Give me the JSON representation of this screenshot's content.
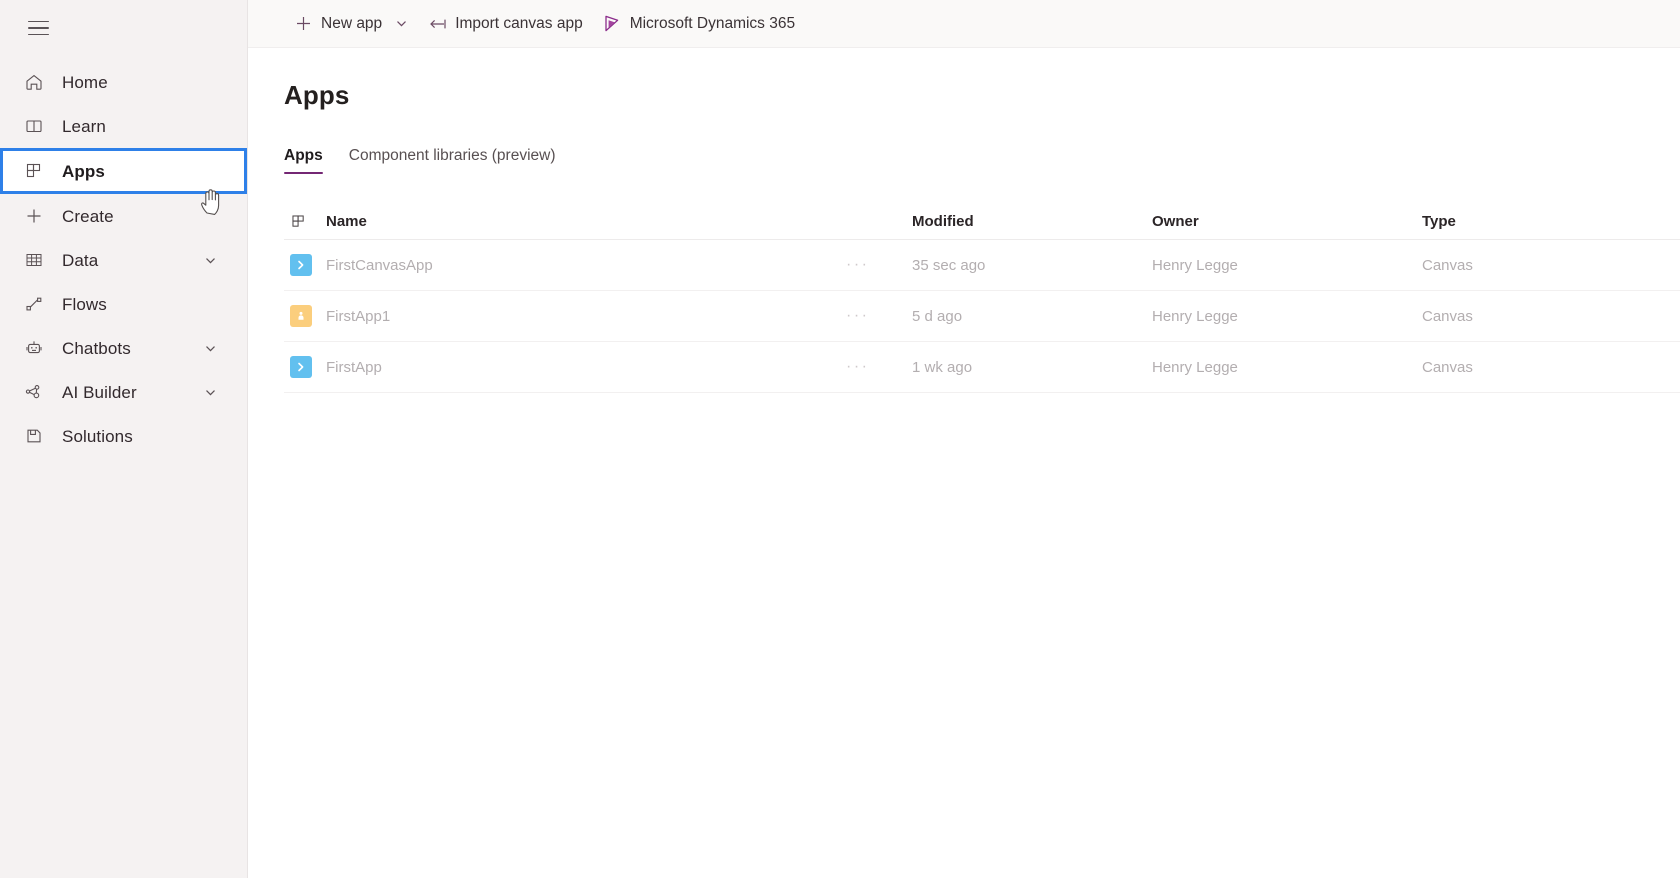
{
  "sidebar": {
    "menu_button": "menu-hamburger",
    "items": [
      {
        "label": "Home",
        "icon": "home-icon",
        "chevron": false,
        "selected": false
      },
      {
        "label": "Learn",
        "icon": "book-icon",
        "chevron": false,
        "selected": false
      },
      {
        "label": "Apps",
        "icon": "apps-grid-icon",
        "chevron": false,
        "selected": true
      },
      {
        "label": "Create",
        "icon": "plus-icon",
        "chevron": false,
        "selected": false
      },
      {
        "label": "Data",
        "icon": "table-icon",
        "chevron": true,
        "selected": false
      },
      {
        "label": "Flows",
        "icon": "flow-icon",
        "chevron": false,
        "selected": false
      },
      {
        "label": "Chatbots",
        "icon": "robot-icon",
        "chevron": true,
        "selected": false
      },
      {
        "label": "AI Builder",
        "icon": "ai-nodes-icon",
        "chevron": true,
        "selected": false
      },
      {
        "label": "Solutions",
        "icon": "solutions-icon",
        "chevron": false,
        "selected": false
      }
    ],
    "selected_highlight_color": "#2e80e8",
    "background_color": "#f5f2f2"
  },
  "command_bar": {
    "commands": [
      {
        "label": "New app",
        "icon": "plus-icon",
        "has_caret": true
      },
      {
        "label": "Import canvas app",
        "icon": "import-arrow-icon",
        "has_caret": false
      },
      {
        "label": "Microsoft Dynamics 365",
        "icon": "dynamics-365-icon",
        "has_caret": false
      }
    ]
  },
  "page": {
    "title": "Apps",
    "tabs": [
      {
        "label": "Apps",
        "active": true
      },
      {
        "label": "Component libraries (preview)",
        "active": false
      }
    ],
    "active_tab_underline_color": "#742774"
  },
  "table": {
    "columns": [
      {
        "key": "icon",
        "label": "",
        "header_icon": "apps-grid-icon"
      },
      {
        "key": "name",
        "label": "Name"
      },
      {
        "key": "dots",
        "label": ""
      },
      {
        "key": "modified",
        "label": "Modified"
      },
      {
        "key": "owner",
        "label": "Owner"
      },
      {
        "key": "type",
        "label": "Type"
      }
    ],
    "rows": [
      {
        "name": "FirstCanvasApp",
        "modified": "35 sec ago",
        "owner": "Henry Legge",
        "type": "Canvas",
        "icon_color": "#62c0ef",
        "icon_glyph": "chevron-right-glyph",
        "overflow_label": "···"
      },
      {
        "name": "FirstApp1",
        "modified": "5 d ago",
        "owner": "Henry Legge",
        "type": "Canvas",
        "icon_color": "#fbce7d",
        "icon_glyph": "person-glyph",
        "overflow_label": "···"
      },
      {
        "name": "FirstApp",
        "modified": "1 wk ago",
        "owner": "Henry Legge",
        "type": "Canvas",
        "icon_color": "#62c0ef",
        "icon_glyph": "chevron-right-glyph",
        "overflow_label": "···"
      }
    ]
  }
}
